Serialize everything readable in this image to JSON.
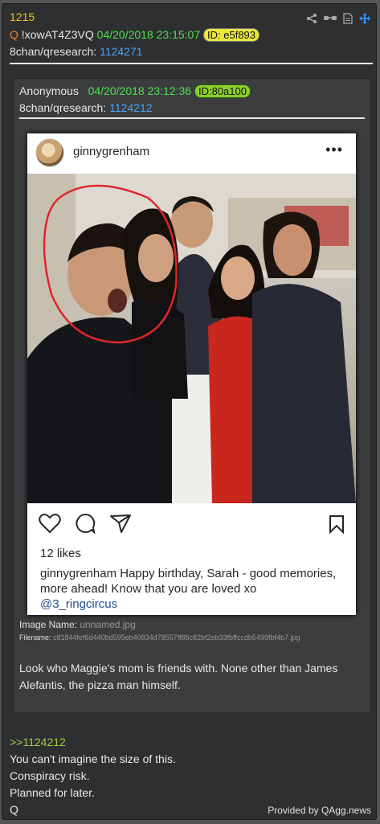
{
  "post": {
    "number": "1215",
    "q_marker": "Q",
    "tripcode": "!xowAT4Z3VQ",
    "date": "04/20/2018 23:15:07",
    "id_label": "ID: e5f893",
    "board": "8chan/qresearch:",
    "post_link": "1124271"
  },
  "tools": {
    "icons": [
      "share-icon",
      "glasses-icon",
      "document-icon",
      "move-icon"
    ]
  },
  "quoted": {
    "author": "Anonymous",
    "date": "04/20/2018 23:12:36",
    "id_label": "ID:80a100",
    "board": "8chan/qresearch:",
    "post_link": "1124212",
    "instagram": {
      "username": "ginnygrenham",
      "menu": "•••",
      "likes": "12 likes",
      "caption_user": "ginnygrenham",
      "caption_text": " Happy birthday, Sarah - good memories, more ahead! Know that you are loved xo",
      "caption_tag": "@3_ringcircus"
    },
    "image_name_label": "Image Name:",
    "image_name": "unnamed.jpg",
    "filename_label": "Filename:",
    "filename": "c81844fef6d440bd595eb40834d78557ff86c82bf2eb33fbffccdb5499fbf4b7.jpg",
    "body": "Look who Maggie's mom is friends with. None other than James Alefantis, the pizza man himself."
  },
  "reply": {
    "quote_link": ">>1124212",
    "lines": [
      "You can't imagine the size of this.",
      "Conspiracy risk.",
      "Planned for later.",
      "Q"
    ]
  },
  "footer": {
    "provided_by": "Provided by QAgg.news"
  },
  "colors": {
    "post_bg": "#2e2f30",
    "quoted_bg": "#3c3d3f",
    "number": "#f0c41b",
    "date": "#4ee04e",
    "link": "#4aa3f0",
    "greentext": "#9fd04a"
  }
}
